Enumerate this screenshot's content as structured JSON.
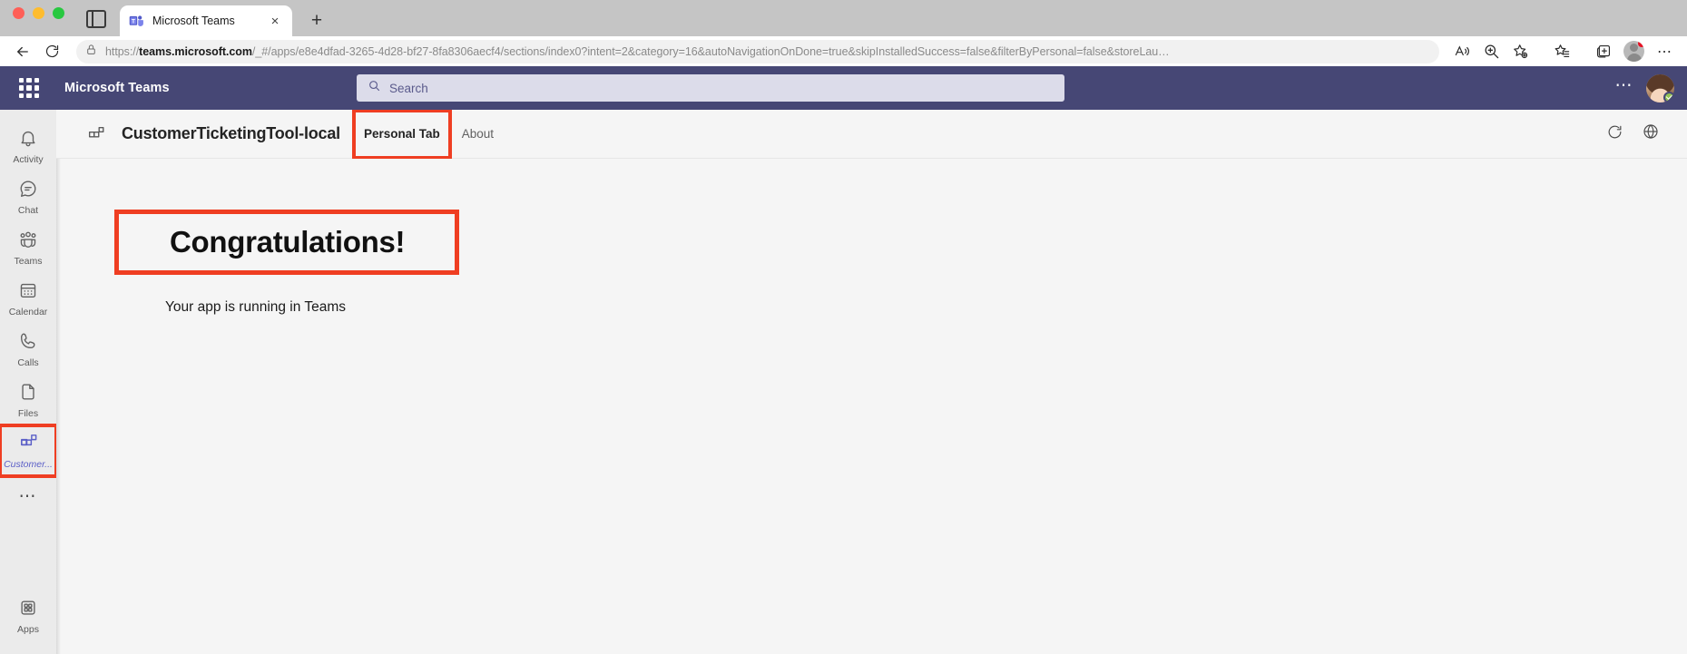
{
  "browser": {
    "tab": {
      "title": "Microsoft Teams",
      "favicon": "teams-favicon",
      "close_label": "×"
    },
    "new_tab_label": "+",
    "back_label": "←",
    "reload_label": "↻",
    "address": {
      "lock_icon": "lock-icon",
      "url_bold": "teams.microsoft.com",
      "url_prefix": "https://",
      "url_suffix": "/_#/apps/e8e4dfad-3265-4d28-bf27-8fa8306aecf4/sections/index0?intent=2&category=16&autoNavigationOnDone=true&skipInstalledSuccess=false&filterByPersonal=false&storeLau…",
      "full_url": "https://teams.microsoft.com/_#/apps/e8e4dfad-3265-4d28-bf27-8fa8306aecf4/sections/index0?intent=2&category=16&autoNavigationOnDone=true&skipInstalledSuccess=false&filterByPersonal=false&storeLau…"
    },
    "toolbar_icons": [
      {
        "name": "read-aloud-icon",
        "glyph": "A"
      },
      {
        "name": "zoom-icon",
        "glyph": "⊕"
      },
      {
        "name": "add-favorite-icon",
        "glyph": "☆"
      },
      {
        "name": "favorites-icon",
        "glyph": "☆"
      },
      {
        "name": "collections-icon",
        "glyph": "⊕"
      },
      {
        "name": "profile-icon",
        "glyph": "●"
      },
      {
        "name": "browser-settings-icon",
        "glyph": "⋯"
      }
    ]
  },
  "teams": {
    "brand": "Microsoft Teams",
    "waffle_label": "app-launcher",
    "search": {
      "placeholder": "Search",
      "icon": "search-icon"
    },
    "header_more_label": "⋯",
    "avatar_name": "user-avatar",
    "presence": "available"
  },
  "rail": {
    "items": [
      {
        "label": "Activity",
        "icon": "bell-icon",
        "active": false
      },
      {
        "label": "Chat",
        "icon": "chat-icon",
        "active": false
      },
      {
        "label": "Teams",
        "icon": "teams-icon",
        "active": false
      },
      {
        "label": "Calendar",
        "icon": "calendar-icon",
        "active": false
      },
      {
        "label": "Calls",
        "icon": "phone-icon",
        "active": false
      },
      {
        "label": "Files",
        "icon": "file-icon",
        "active": false
      },
      {
        "label": "Customer...",
        "icon": "app-grid-icon",
        "active": true
      }
    ],
    "more_label": "⋯",
    "apps": {
      "label": "Apps",
      "icon": "apps-icon"
    }
  },
  "app": {
    "icon": "app-grid-icon",
    "title": "CustomerTicketingTool-local",
    "tabs": [
      {
        "label": "Personal Tab",
        "selected": true,
        "highlighted": true
      },
      {
        "label": "About",
        "selected": false,
        "highlighted": false
      }
    ],
    "header_actions": [
      {
        "name": "refresh-icon",
        "label": "Refresh"
      },
      {
        "name": "globe-icon",
        "label": "Open in browser"
      }
    ],
    "content": {
      "heading": "Congratulations!",
      "subtext": "Your app is running in Teams"
    }
  },
  "colors": {
    "teams_purple": "#464775",
    "highlight_red": "#ef3e22",
    "accent_link": "#5b5fc7",
    "content_bg": "#f5f5f5",
    "rail_bg": "#ebebeb"
  }
}
